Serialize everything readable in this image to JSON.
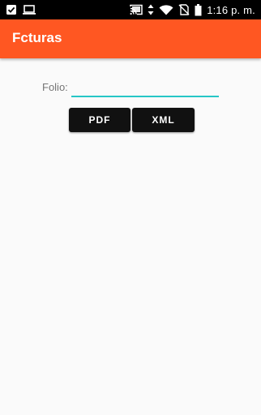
{
  "status_bar": {
    "time": "1:16 p. m.",
    "left_icons": [
      "checkbox-notification-icon",
      "laptop-icon"
    ],
    "right_icons": [
      "cast-icon",
      "data-arrows-icon",
      "wifi-icon",
      "no-sim-icon",
      "battery-icon"
    ]
  },
  "app_bar": {
    "title": "Fcturas",
    "color": "#ff5722"
  },
  "form": {
    "folio_label": "Folio:",
    "folio_value": "",
    "underline_color": "#26c6c6"
  },
  "buttons": {
    "pdf_label": "PDF",
    "xml_label": "XML"
  }
}
